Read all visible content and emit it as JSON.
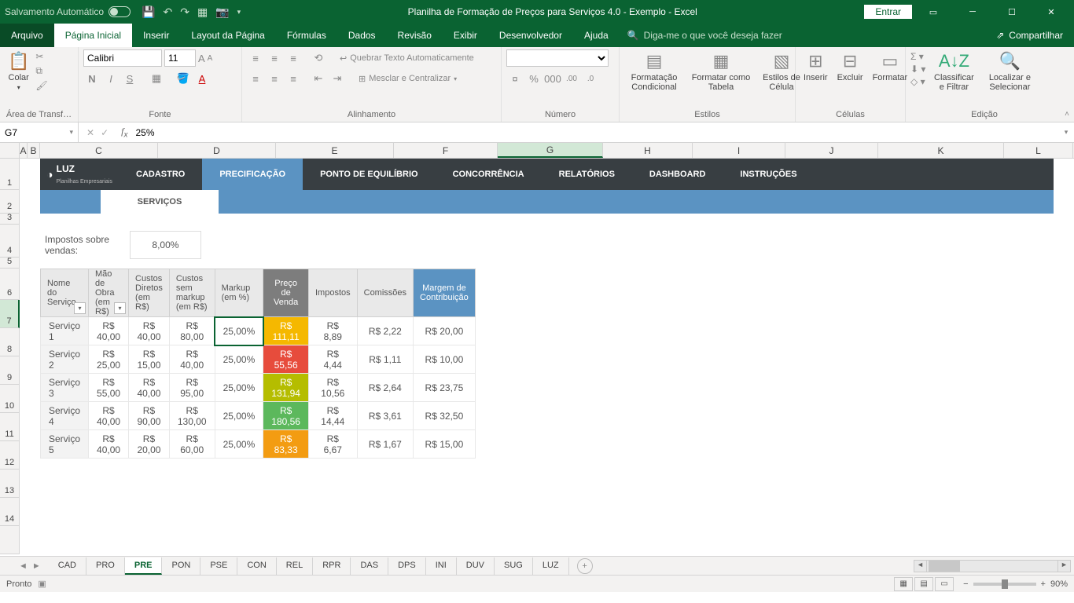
{
  "titlebar": {
    "autosave": "Salvamento Automático",
    "title": "Planilha de Formação de Preços para Serviços 4.0 - Exemplo  -  Excel",
    "entrar": "Entrar"
  },
  "menu": {
    "file": "Arquivo",
    "tabs": [
      "Página Inicial",
      "Inserir",
      "Layout da Página",
      "Fórmulas",
      "Dados",
      "Revisão",
      "Exibir",
      "Desenvolvedor",
      "Ajuda"
    ],
    "active": 0,
    "tellme": "Diga-me o que você deseja fazer",
    "share": "Compartilhar"
  },
  "ribbon": {
    "clipboard": {
      "paste": "Colar",
      "label": "Área de Transf…"
    },
    "font": {
      "name": "Calibri",
      "size": "11",
      "label": "Fonte"
    },
    "alignment": {
      "wrap": "Quebrar Texto Automaticamente",
      "merge": "Mesclar e Centralizar",
      "label": "Alinhamento"
    },
    "number": {
      "label": "Número"
    },
    "styles": {
      "cond": "Formatação Condicional",
      "table": "Formatar como Tabela",
      "cell": "Estilos de Célula",
      "label": "Estilos"
    },
    "cells": {
      "insert": "Inserir",
      "delete": "Excluir",
      "format": "Formatar",
      "label": "Células"
    },
    "editing": {
      "sort": "Classificar e Filtrar",
      "find": "Localizar e Selecionar",
      "label": "Edição"
    }
  },
  "fx": {
    "namebox": "G7",
    "formula": "25%"
  },
  "columns": [
    "A",
    "B",
    "C",
    "D",
    "E",
    "F",
    "G",
    "H",
    "I",
    "J",
    "K",
    "L"
  ],
  "worksheet": {
    "logo_brand": "LUZ",
    "logo_sub": "Planilhas Empresariais",
    "nav": [
      "CADASTRO",
      "PRECIFICAÇÃO",
      "PONTO DE EQUILÍBRIO",
      "CONCORRÊNCIA",
      "RELATÓRIOS",
      "DASHBOARD",
      "INSTRUÇÕES"
    ],
    "nav_active": 1,
    "servicos_tab": "SERVIÇOS",
    "tax_label": "Impostos sobre vendas:",
    "tax_value": "8,00%",
    "headers": [
      "Nome do Serviço",
      "Mão de Obra (em R$)",
      "Custos Diretos (em R$)",
      "Custos sem markup (em R$)",
      "Markup (em %)",
      "Preço de Venda",
      "Impostos",
      "Comissões",
      "Margem de Contribuição"
    ],
    "rows": [
      {
        "name": "Serviço 1",
        "mao": "R$ 40,00",
        "custos": "R$ 40,00",
        "sem": "R$ 80,00",
        "mk": "25,00%",
        "preco": "R$ 111,11",
        "cls": "price-yellow",
        "imp": "R$ 8,89",
        "com": "R$ 2,22",
        "marg": "R$ 20,00"
      },
      {
        "name": "Serviço 2",
        "mao": "R$ 25,00",
        "custos": "R$ 15,00",
        "sem": "R$ 40,00",
        "mk": "25,00%",
        "preco": "R$ 55,56",
        "cls": "price-red",
        "imp": "R$ 4,44",
        "com": "R$ 1,11",
        "marg": "R$ 10,00"
      },
      {
        "name": "Serviço 3",
        "mao": "R$ 55,00",
        "custos": "R$ 40,00",
        "sem": "R$ 95,00",
        "mk": "25,00%",
        "preco": "R$ 131,94",
        "cls": "price-olive",
        "imp": "R$ 10,56",
        "com": "R$ 2,64",
        "marg": "R$ 23,75"
      },
      {
        "name": "Serviço 4",
        "mao": "R$ 40,00",
        "custos": "R$ 90,00",
        "sem": "R$ 130,00",
        "mk": "25,00%",
        "preco": "R$ 180,56",
        "cls": "price-green",
        "imp": "R$ 14,44",
        "com": "R$ 3,61",
        "marg": "R$ 32,50"
      },
      {
        "name": "Serviço 5",
        "mao": "R$ 40,00",
        "custos": "R$ 20,00",
        "sem": "R$ 60,00",
        "mk": "25,00%",
        "preco": "R$ 83,33",
        "cls": "price-orange",
        "imp": "R$ 6,67",
        "com": "R$ 1,67",
        "marg": "R$ 15,00"
      }
    ]
  },
  "sheets": [
    "CAD",
    "PRO",
    "PRE",
    "PON",
    "PSE",
    "CON",
    "REL",
    "RPR",
    "DAS",
    "DPS",
    "INI",
    "DUV",
    "SUG",
    "LUZ"
  ],
  "sheet_active": 2,
  "status": {
    "ready": "Pronto",
    "zoom": "90%"
  }
}
